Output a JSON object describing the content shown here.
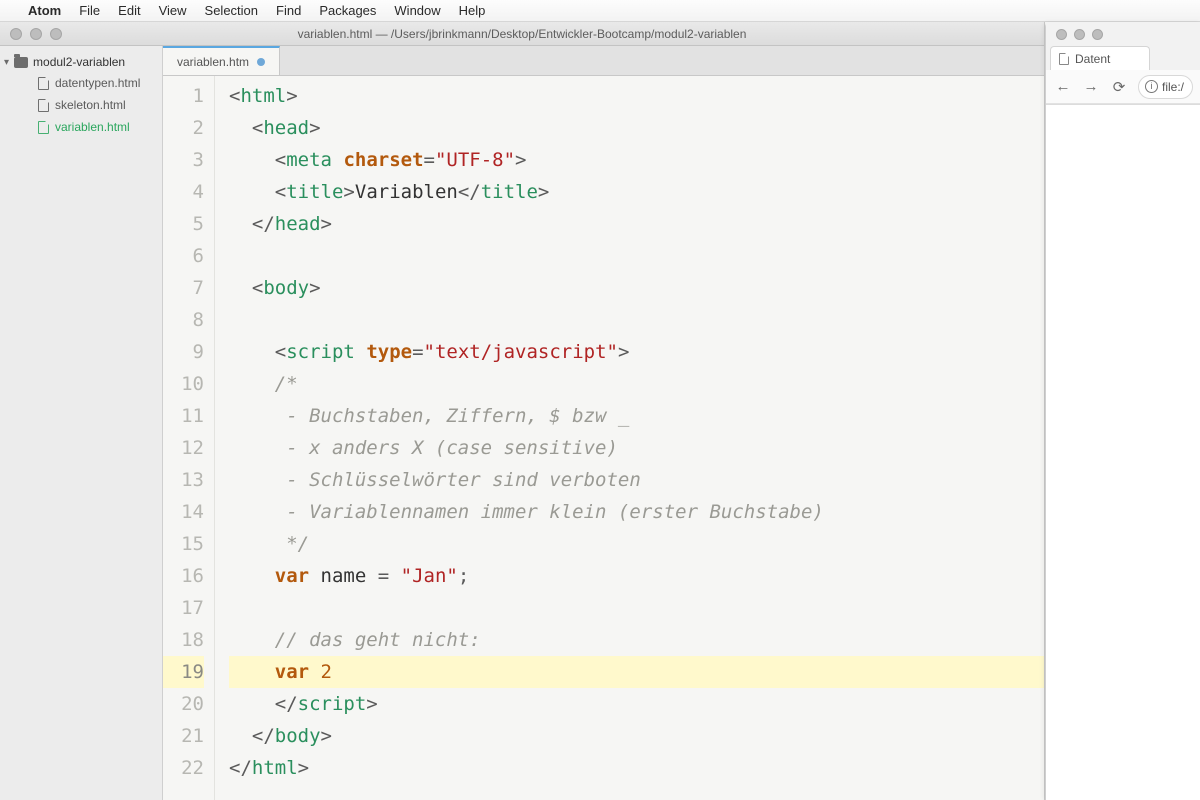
{
  "menubar": {
    "apple": "",
    "items": [
      "Atom",
      "File",
      "Edit",
      "View",
      "Selection",
      "Find",
      "Packages",
      "Window",
      "Help"
    ]
  },
  "window": {
    "title": "variablen.html — /Users/jbrinkmann/Desktop/Entwickler-Bootcamp/modul2-variablen"
  },
  "sidebar": {
    "root": "modul2-variablen",
    "files": [
      {
        "name": "datentypen.html",
        "active": false
      },
      {
        "name": "skeleton.html",
        "active": false
      },
      {
        "name": "variablen.html",
        "active": true
      }
    ]
  },
  "tabs": {
    "active": {
      "label": "variablen.htm",
      "modified": true
    }
  },
  "code": {
    "highlighted_line": 19,
    "lines": [
      {
        "n": 1,
        "indent": 0,
        "seg": [
          [
            "pun",
            "<"
          ],
          [
            "tagc",
            "html"
          ],
          [
            "pun",
            ">"
          ]
        ]
      },
      {
        "n": 2,
        "indent": 1,
        "seg": [
          [
            "pun",
            "<"
          ],
          [
            "tagc",
            "head"
          ],
          [
            "pun",
            ">"
          ]
        ]
      },
      {
        "n": 3,
        "indent": 2,
        "seg": [
          [
            "pun",
            "<"
          ],
          [
            "tagc",
            "meta"
          ],
          [
            "txt",
            " "
          ],
          [
            "attr",
            "charset"
          ],
          [
            "pun",
            "="
          ],
          [
            "str",
            "\"UTF-8\""
          ],
          [
            "pun",
            ">"
          ]
        ]
      },
      {
        "n": 4,
        "indent": 2,
        "seg": [
          [
            "pun",
            "<"
          ],
          [
            "tagc",
            "title"
          ],
          [
            "pun",
            ">"
          ],
          [
            "txt",
            "Variablen"
          ],
          [
            "pun",
            "</"
          ],
          [
            "tagc",
            "title"
          ],
          [
            "pun",
            ">"
          ]
        ]
      },
      {
        "n": 5,
        "indent": 1,
        "seg": [
          [
            "pun",
            "</"
          ],
          [
            "tagc",
            "head"
          ],
          [
            "pun",
            ">"
          ]
        ]
      },
      {
        "n": 6,
        "indent": 0,
        "seg": []
      },
      {
        "n": 7,
        "indent": 1,
        "seg": [
          [
            "pun",
            "<"
          ],
          [
            "tagc",
            "body"
          ],
          [
            "pun",
            ">"
          ]
        ]
      },
      {
        "n": 8,
        "indent": 0,
        "seg": []
      },
      {
        "n": 9,
        "indent": 2,
        "seg": [
          [
            "pun",
            "<"
          ],
          [
            "tagc",
            "script"
          ],
          [
            "txt",
            " "
          ],
          [
            "attr",
            "type"
          ],
          [
            "pun",
            "="
          ],
          [
            "str",
            "\"text/javascript\""
          ],
          [
            "pun",
            ">"
          ]
        ]
      },
      {
        "n": 10,
        "indent": 2,
        "seg": [
          [
            "cmt",
            "/*"
          ]
        ]
      },
      {
        "n": 11,
        "indent": 2,
        "seg": [
          [
            "cmt",
            " - Buchstaben, Ziffern, $ bzw _"
          ]
        ]
      },
      {
        "n": 12,
        "indent": 2,
        "seg": [
          [
            "cmt",
            " - x anders X (case sensitive)"
          ]
        ]
      },
      {
        "n": 13,
        "indent": 2,
        "seg": [
          [
            "cmt",
            " - Schlüsselwörter sind verboten"
          ]
        ]
      },
      {
        "n": 14,
        "indent": 2,
        "seg": [
          [
            "cmt",
            " - Variablennamen immer klein (erster Buchstabe)"
          ]
        ]
      },
      {
        "n": 15,
        "indent": 2,
        "seg": [
          [
            "cmt",
            " */"
          ]
        ]
      },
      {
        "n": 16,
        "indent": 2,
        "seg": [
          [
            "kw",
            "var"
          ],
          [
            "txt",
            " name "
          ],
          [
            "pun",
            "= "
          ],
          [
            "str",
            "\"Jan\""
          ],
          [
            "pun",
            ";"
          ]
        ]
      },
      {
        "n": 17,
        "indent": 0,
        "seg": []
      },
      {
        "n": 18,
        "indent": 2,
        "seg": [
          [
            "cmt",
            "// das geht nicht:"
          ]
        ]
      },
      {
        "n": 19,
        "indent": 2,
        "seg": [
          [
            "kw",
            "var"
          ],
          [
            "txt",
            " "
          ],
          [
            "num",
            "2"
          ]
        ]
      },
      {
        "n": 20,
        "indent": 2,
        "seg": [
          [
            "pun",
            "</"
          ],
          [
            "tagc",
            "script"
          ],
          [
            "pun",
            ">"
          ]
        ]
      },
      {
        "n": 21,
        "indent": 1,
        "seg": [
          [
            "pun",
            "</"
          ],
          [
            "tagc",
            "body"
          ],
          [
            "pun",
            ">"
          ]
        ]
      },
      {
        "n": 22,
        "indent": 0,
        "seg": [
          [
            "pun",
            "</"
          ],
          [
            "tagc",
            "html"
          ],
          [
            "pun",
            ">"
          ]
        ]
      }
    ]
  },
  "browser": {
    "tab_label": "Datent",
    "url_prefix": "file:/"
  }
}
